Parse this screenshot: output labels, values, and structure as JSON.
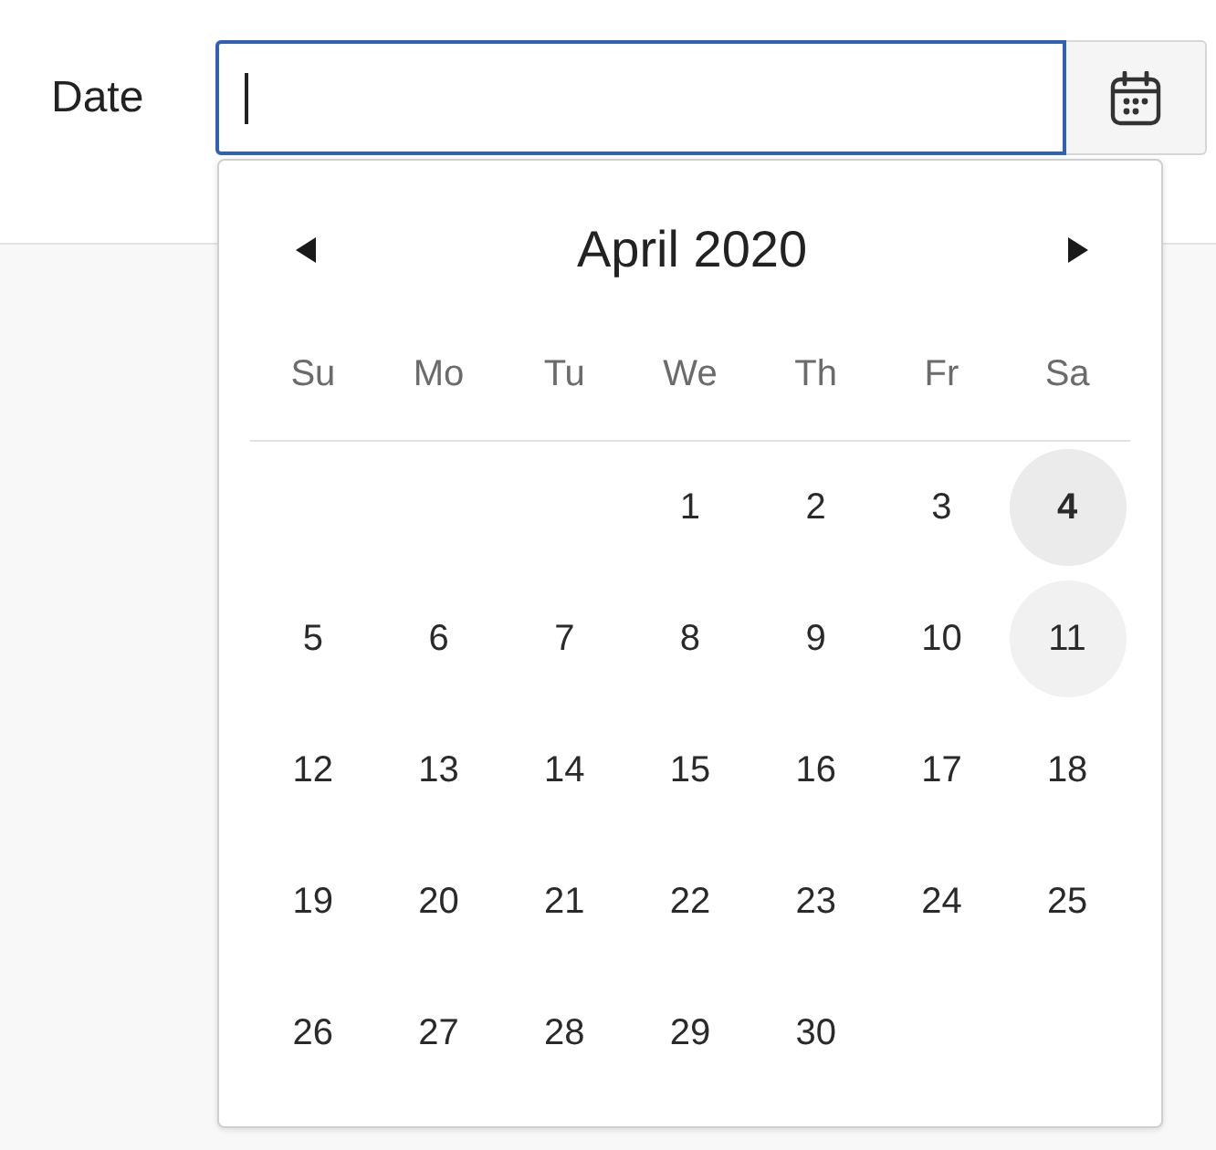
{
  "form": {
    "label": "Date",
    "date_field": {
      "focused": true
    }
  },
  "calendar": {
    "title": "April 2020",
    "weekdays": [
      "Su",
      "Mo",
      "Tu",
      "We",
      "Th",
      "Fr",
      "Sa"
    ],
    "weeks": [
      [
        {
          "kind": "blank"
        },
        {
          "kind": "blank"
        },
        {
          "kind": "blank"
        },
        {
          "kind": "day",
          "label": "1",
          "today": false,
          "hovered": false
        },
        {
          "kind": "day",
          "label": "2",
          "today": false,
          "hovered": false
        },
        {
          "kind": "day",
          "label": "3",
          "today": false,
          "hovered": false
        },
        {
          "kind": "day",
          "label": "4",
          "today": true,
          "hovered": false
        }
      ],
      [
        {
          "kind": "day",
          "label": "5",
          "today": false,
          "hovered": false
        },
        {
          "kind": "day",
          "label": "6",
          "today": false,
          "hovered": false
        },
        {
          "kind": "day",
          "label": "7",
          "today": false,
          "hovered": false
        },
        {
          "kind": "day",
          "label": "8",
          "today": false,
          "hovered": false
        },
        {
          "kind": "day",
          "label": "9",
          "today": false,
          "hovered": false
        },
        {
          "kind": "day",
          "label": "10",
          "today": false,
          "hovered": false
        },
        {
          "kind": "day",
          "label": "11",
          "today": false,
          "hovered": true
        }
      ],
      [
        {
          "kind": "day",
          "label": "12",
          "today": false,
          "hovered": false
        },
        {
          "kind": "day",
          "label": "13",
          "today": false,
          "hovered": false
        },
        {
          "kind": "day",
          "label": "14",
          "today": false,
          "hovered": false
        },
        {
          "kind": "day",
          "label": "15",
          "today": false,
          "hovered": false
        },
        {
          "kind": "day",
          "label": "16",
          "today": false,
          "hovered": false
        },
        {
          "kind": "day",
          "label": "17",
          "today": false,
          "hovered": false
        },
        {
          "kind": "day",
          "label": "18",
          "today": false,
          "hovered": false
        }
      ],
      [
        {
          "kind": "day",
          "label": "19",
          "today": false,
          "hovered": false
        },
        {
          "kind": "day",
          "label": "20",
          "today": false,
          "hovered": false
        },
        {
          "kind": "day",
          "label": "21",
          "today": false,
          "hovered": false
        },
        {
          "kind": "day",
          "label": "22",
          "today": false,
          "hovered": false
        },
        {
          "kind": "day",
          "label": "23",
          "today": false,
          "hovered": false
        },
        {
          "kind": "day",
          "label": "24",
          "today": false,
          "hovered": false
        },
        {
          "kind": "day",
          "label": "25",
          "today": false,
          "hovered": false
        }
      ],
      [
        {
          "kind": "day",
          "label": "26",
          "today": false,
          "hovered": false
        },
        {
          "kind": "day",
          "label": "27",
          "today": false,
          "hovered": false
        },
        {
          "kind": "day",
          "label": "28",
          "today": false,
          "hovered": false
        },
        {
          "kind": "day",
          "label": "29",
          "today": false,
          "hovered": false
        },
        {
          "kind": "day",
          "label": "30",
          "today": false,
          "hovered": false
        },
        {
          "kind": "blank"
        },
        {
          "kind": "blank"
        }
      ]
    ]
  }
}
